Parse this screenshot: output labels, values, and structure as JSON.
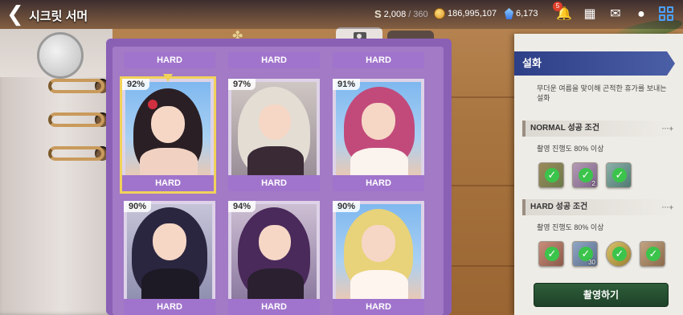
{
  "header": {
    "title": "시크릿 서머",
    "stamina_current": "2,008",
    "stamina_sep": "/",
    "stamina_max": "360",
    "gold": "186,995,107",
    "gems": "6,173",
    "notification_count": "5"
  },
  "album": {
    "top_row_labels": [
      "HARD",
      "HARD",
      "HARD"
    ],
    "cards": [
      {
        "percent": "92%",
        "label": "HARD",
        "selected": true
      },
      {
        "percent": "97%",
        "label": "HARD",
        "selected": false
      },
      {
        "percent": "91%",
        "label": "HARD",
        "selected": false
      },
      {
        "percent": "90%",
        "label": "HARD",
        "selected": false
      },
      {
        "percent": "94%",
        "label": "HARD",
        "selected": false
      },
      {
        "percent": "90%",
        "label": "HARD",
        "selected": false
      }
    ]
  },
  "panel": {
    "title": "설화",
    "description": "무더운 여름을 맞이해 곤적한 휴가를 보내는 설화",
    "normal": {
      "heading": "NORMAL 성공 조건",
      "more": "···+",
      "condition": "촬영 진행도 80% 이상",
      "reward_qtys": [
        "",
        "2",
        ""
      ]
    },
    "hard": {
      "heading": "HARD 성공 조건",
      "more": "···+",
      "condition": "촬영 진행도 80% 이상",
      "reward_qtys": [
        "",
        "30",
        "",
        ""
      ]
    },
    "shoot_button": "촬영하기"
  },
  "colors": {
    "album_purple": "#a074cc",
    "selected_outline": "#f1d25a",
    "panel_header": "#2d3f86",
    "check_green": "#3bc44b",
    "shoot_button": "#2f5e3a"
  }
}
